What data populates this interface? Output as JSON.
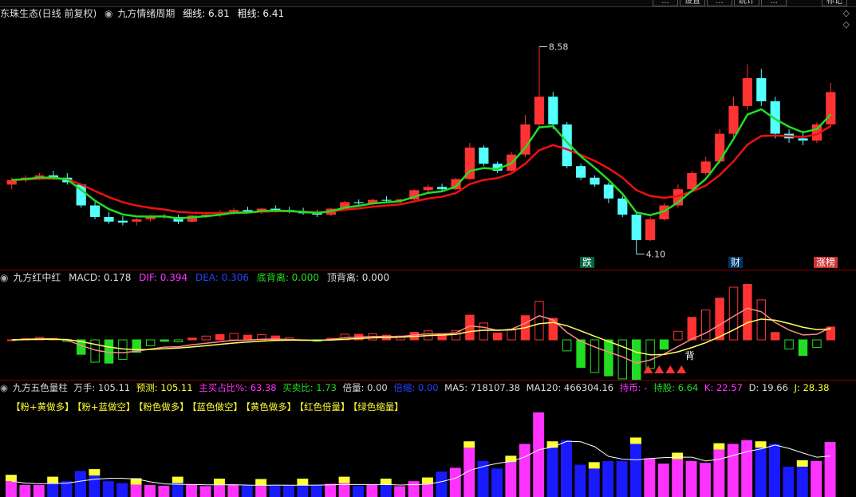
{
  "top_buttons": [
    "...",
    "设置",
    "...",
    "统计",
    "...",
    "标记"
  ],
  "main": {
    "title": "东珠生态(日线 前复权)",
    "indicator": "九方情绪周期",
    "fine_label": "细线: 6.81",
    "coarse_label": "粗线: 6.41",
    "high_price": "8.58",
    "low_price": "4.10",
    "tags": [
      "跌",
      "财",
      "涨榜"
    ]
  },
  "macd": {
    "name": "九方红中红",
    "macd": "MACD: 0.178",
    "dif": "DIF: 0.394",
    "dea": "DEA: 0.306",
    "bottom_div": "底背离: 0.000",
    "top_div": "顶背离: 0.000",
    "marker": "背"
  },
  "vol": {
    "name": "九方五色量柱",
    "wanshou": "万手: 105.11",
    "forecast": "预测: 105.11",
    "main_buy": "主买占比%: 63.38",
    "buy_sell": "买卖比: 1.73",
    "ratio": "倍量: 0.00",
    "shrink": "倍缩: 0.00",
    "ma5": "MA5: 718107.38",
    "ma120": "MA120: 466304.16",
    "hold_coin": "持币: -",
    "hold_stock": "持股: 6.64",
    "k": "K: 22.57",
    "d": "D: 19.66",
    "j": "J: 28.38",
    "legend": [
      "【粉+黄做多】",
      "【粉+蓝做空】",
      "【粉色做多】",
      "【蓝色做空】",
      "【黄色做多】",
      "【红色倍量】",
      "【绿色缩量】"
    ]
  },
  "colors": {
    "up": "#ff3333",
    "down": "#54ffff",
    "green_line": "#22dd22",
    "red_line": "#ee1111",
    "pink": "#ff33ff",
    "blue": "#1a1aff",
    "yellow": "#ffff33",
    "accent": "#ffff66"
  },
  "chart_data": {
    "type": "candlestick",
    "categories_count": 60,
    "ohlc": [
      [
        5.6,
        5.75,
        5.5,
        5.7
      ],
      [
        5.7,
        5.8,
        5.65,
        5.75
      ],
      [
        5.75,
        5.85,
        5.7,
        5.8
      ],
      [
        5.8,
        5.9,
        5.7,
        5.75
      ],
      [
        5.75,
        5.85,
        5.6,
        5.65
      ],
      [
        5.6,
        5.62,
        5.1,
        5.15
      ],
      [
        5.15,
        5.25,
        4.85,
        4.9
      ],
      [
        4.9,
        5.0,
        4.75,
        4.8
      ],
      [
        4.82,
        4.92,
        4.72,
        4.78
      ],
      [
        4.8,
        4.88,
        4.72,
        4.85
      ],
      [
        4.85,
        4.95,
        4.8,
        4.9
      ],
      [
        4.9,
        4.98,
        4.85,
        4.92
      ],
      [
        4.9,
        4.95,
        4.75,
        4.8
      ],
      [
        4.8,
        4.95,
        4.78,
        4.93
      ],
      [
        4.93,
        5.0,
        4.88,
        4.95
      ],
      [
        4.95,
        5.05,
        4.9,
        5.0
      ],
      [
        5.0,
        5.1,
        4.95,
        5.05
      ],
      [
        5.05,
        5.12,
        4.98,
        5.0
      ],
      [
        5.0,
        5.1,
        4.96,
        5.08
      ],
      [
        5.08,
        5.15,
        5.0,
        5.05
      ],
      [
        5.05,
        5.12,
        4.98,
        5.02
      ],
      [
        5.02,
        5.1,
        4.95,
        4.98
      ],
      [
        4.98,
        5.05,
        4.9,
        4.95
      ],
      [
        4.95,
        5.1,
        4.92,
        5.08
      ],
      [
        5.08,
        5.25,
        5.05,
        5.22
      ],
      [
        5.22,
        5.28,
        5.15,
        5.2
      ],
      [
        5.2,
        5.3,
        5.15,
        5.27
      ],
      [
        5.27,
        5.35,
        5.2,
        5.25
      ],
      [
        5.25,
        5.3,
        5.18,
        5.28
      ],
      [
        5.28,
        5.5,
        5.25,
        5.48
      ],
      [
        5.48,
        5.6,
        5.42,
        5.55
      ],
      [
        5.55,
        5.62,
        5.45,
        5.5
      ],
      [
        5.5,
        5.75,
        5.48,
        5.72
      ],
      [
        5.72,
        6.5,
        5.7,
        6.4
      ],
      [
        6.4,
        6.45,
        6.0,
        6.05
      ],
      [
        6.05,
        6.1,
        5.85,
        5.9
      ],
      [
        5.9,
        6.3,
        5.88,
        6.25
      ],
      [
        6.25,
        7.1,
        6.2,
        6.9
      ],
      [
        6.9,
        8.58,
        6.85,
        7.5
      ],
      [
        7.5,
        7.6,
        6.8,
        6.9
      ],
      [
        6.9,
        6.95,
        5.95,
        6.0
      ],
      [
        6.0,
        6.05,
        5.7,
        5.75
      ],
      [
        5.75,
        5.8,
        5.55,
        5.6
      ],
      [
        5.6,
        5.65,
        5.2,
        5.3
      ],
      [
        5.3,
        5.35,
        4.9,
        4.95
      ],
      [
        4.95,
        5.0,
        4.1,
        4.4
      ],
      [
        4.4,
        4.9,
        4.38,
        4.85
      ],
      [
        4.85,
        5.2,
        4.82,
        5.15
      ],
      [
        5.15,
        5.6,
        5.1,
        5.5
      ],
      [
        5.5,
        5.9,
        5.45,
        5.85
      ],
      [
        5.85,
        6.2,
        5.8,
        6.1
      ],
      [
        6.1,
        6.8,
        6.05,
        6.7
      ],
      [
        6.7,
        7.5,
        6.6,
        7.3
      ],
      [
        7.3,
        8.2,
        7.2,
        7.9
      ],
      [
        7.9,
        8.1,
        7.3,
        7.4
      ],
      [
        7.4,
        7.5,
        6.6,
        6.7
      ],
      [
        6.7,
        6.8,
        6.5,
        6.6
      ],
      [
        6.6,
        6.75,
        6.45,
        6.55
      ],
      [
        6.55,
        6.95,
        6.5,
        6.9
      ],
      [
        6.9,
        7.8,
        6.85,
        7.6
      ]
    ],
    "ylim": [
      3.9,
      8.9
    ]
  }
}
